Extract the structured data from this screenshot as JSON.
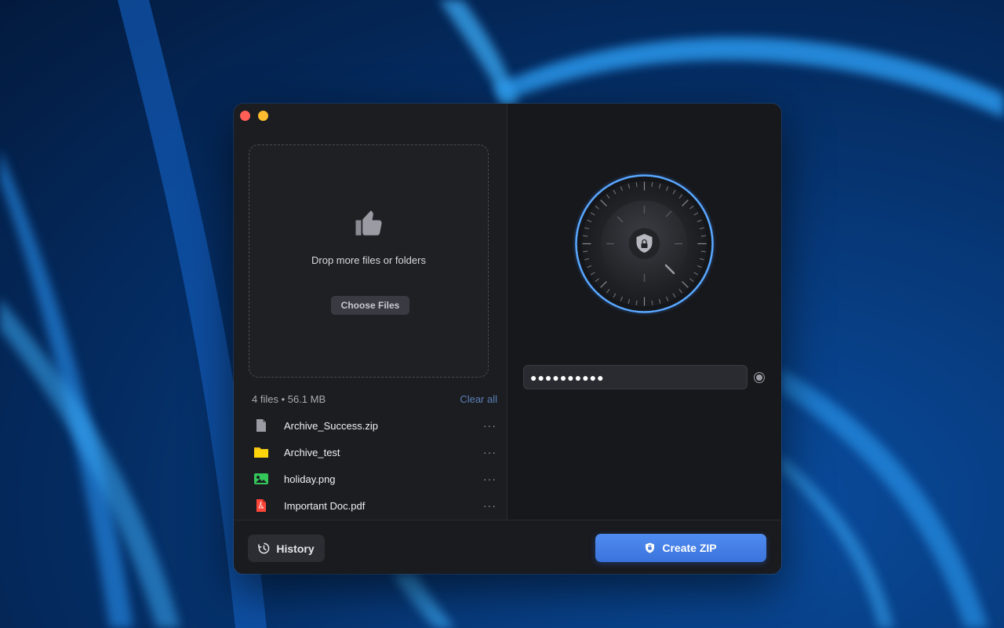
{
  "dropzone": {
    "icon": "thumbs-up-icon",
    "message": "Drop more files or folders",
    "choose_label": "Choose Files"
  },
  "summary": {
    "count_label": "4 files • 56.1 MB",
    "clear_label": "Clear all"
  },
  "files": [
    {
      "name": "Archive_Success.zip",
      "icon": "document-icon",
      "color": "#9a9ba3"
    },
    {
      "name": "Archive_test",
      "icon": "folder-icon",
      "color": "#f5c518"
    },
    {
      "name": "holiday.png",
      "icon": "image-icon",
      "color": "#34c759"
    },
    {
      "name": "Important Doc.pdf",
      "icon": "pdf-icon",
      "color": "#ff453a"
    }
  ],
  "more_label": "···",
  "password": {
    "value": "●●●●●●●●●●"
  },
  "footer": {
    "history_label": "History",
    "create_label": "Create ZIP"
  },
  "colors": {
    "accent": "#4a86ee",
    "close": "#ff5f57",
    "minimize": "#febc2e",
    "dial_ring": "#5aa8ff"
  }
}
